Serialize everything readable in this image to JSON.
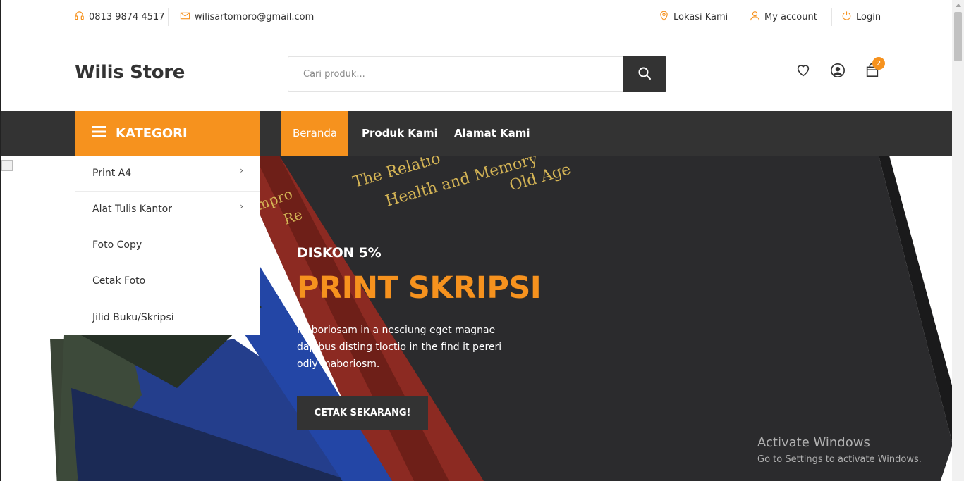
{
  "topbar": {
    "phone": "0813 9874 4517",
    "email": "wilisartomoro@gmail.com",
    "location": "Lokasi Kami",
    "account": "My account",
    "login": "Login"
  },
  "header": {
    "brand": "Wilis Store",
    "search_placeholder": "Cari produk...",
    "cart_count": "2"
  },
  "nav": {
    "kategori_label": "KATEGORI",
    "links": [
      "Beranda",
      "Produk Kami",
      "Alamat Kami"
    ]
  },
  "categories": [
    {
      "label": "Print A4",
      "has_sub": true
    },
    {
      "label": "Alat Tulis Kantor",
      "has_sub": true
    },
    {
      "label": "Foto Copy",
      "has_sub": false
    },
    {
      "label": "Cetak Foto",
      "has_sub": false
    },
    {
      "label": "Jilid Buku/Skripsi",
      "has_sub": false
    }
  ],
  "hero": {
    "discount": "DISKON 5%",
    "headline": "PRINT SKRIPSI",
    "description": "Maboriosam in a nesciung eget magnae dapibus disting tloctio in the find it pereri odiy maboriosm.",
    "cta": "CETAK SEKARANG!",
    "book_text_1": "The Relatio",
    "book_text_2": "Health and Memory",
    "book_text_3": "Old Age",
    "book_text_4": "mpro",
    "book_text_5": "Re"
  },
  "watermark": {
    "line1": "Activate Windows",
    "line2": "Go to Settings to activate Windows."
  },
  "colors": {
    "accent": "#f6921e",
    "dark": "#333333",
    "book_black": "#2b2b2d",
    "book_red": "#8c2a22",
    "book_blue": "#1f3f8f",
    "book_green": "#2f3a30",
    "gold_text": "#d4b455"
  }
}
